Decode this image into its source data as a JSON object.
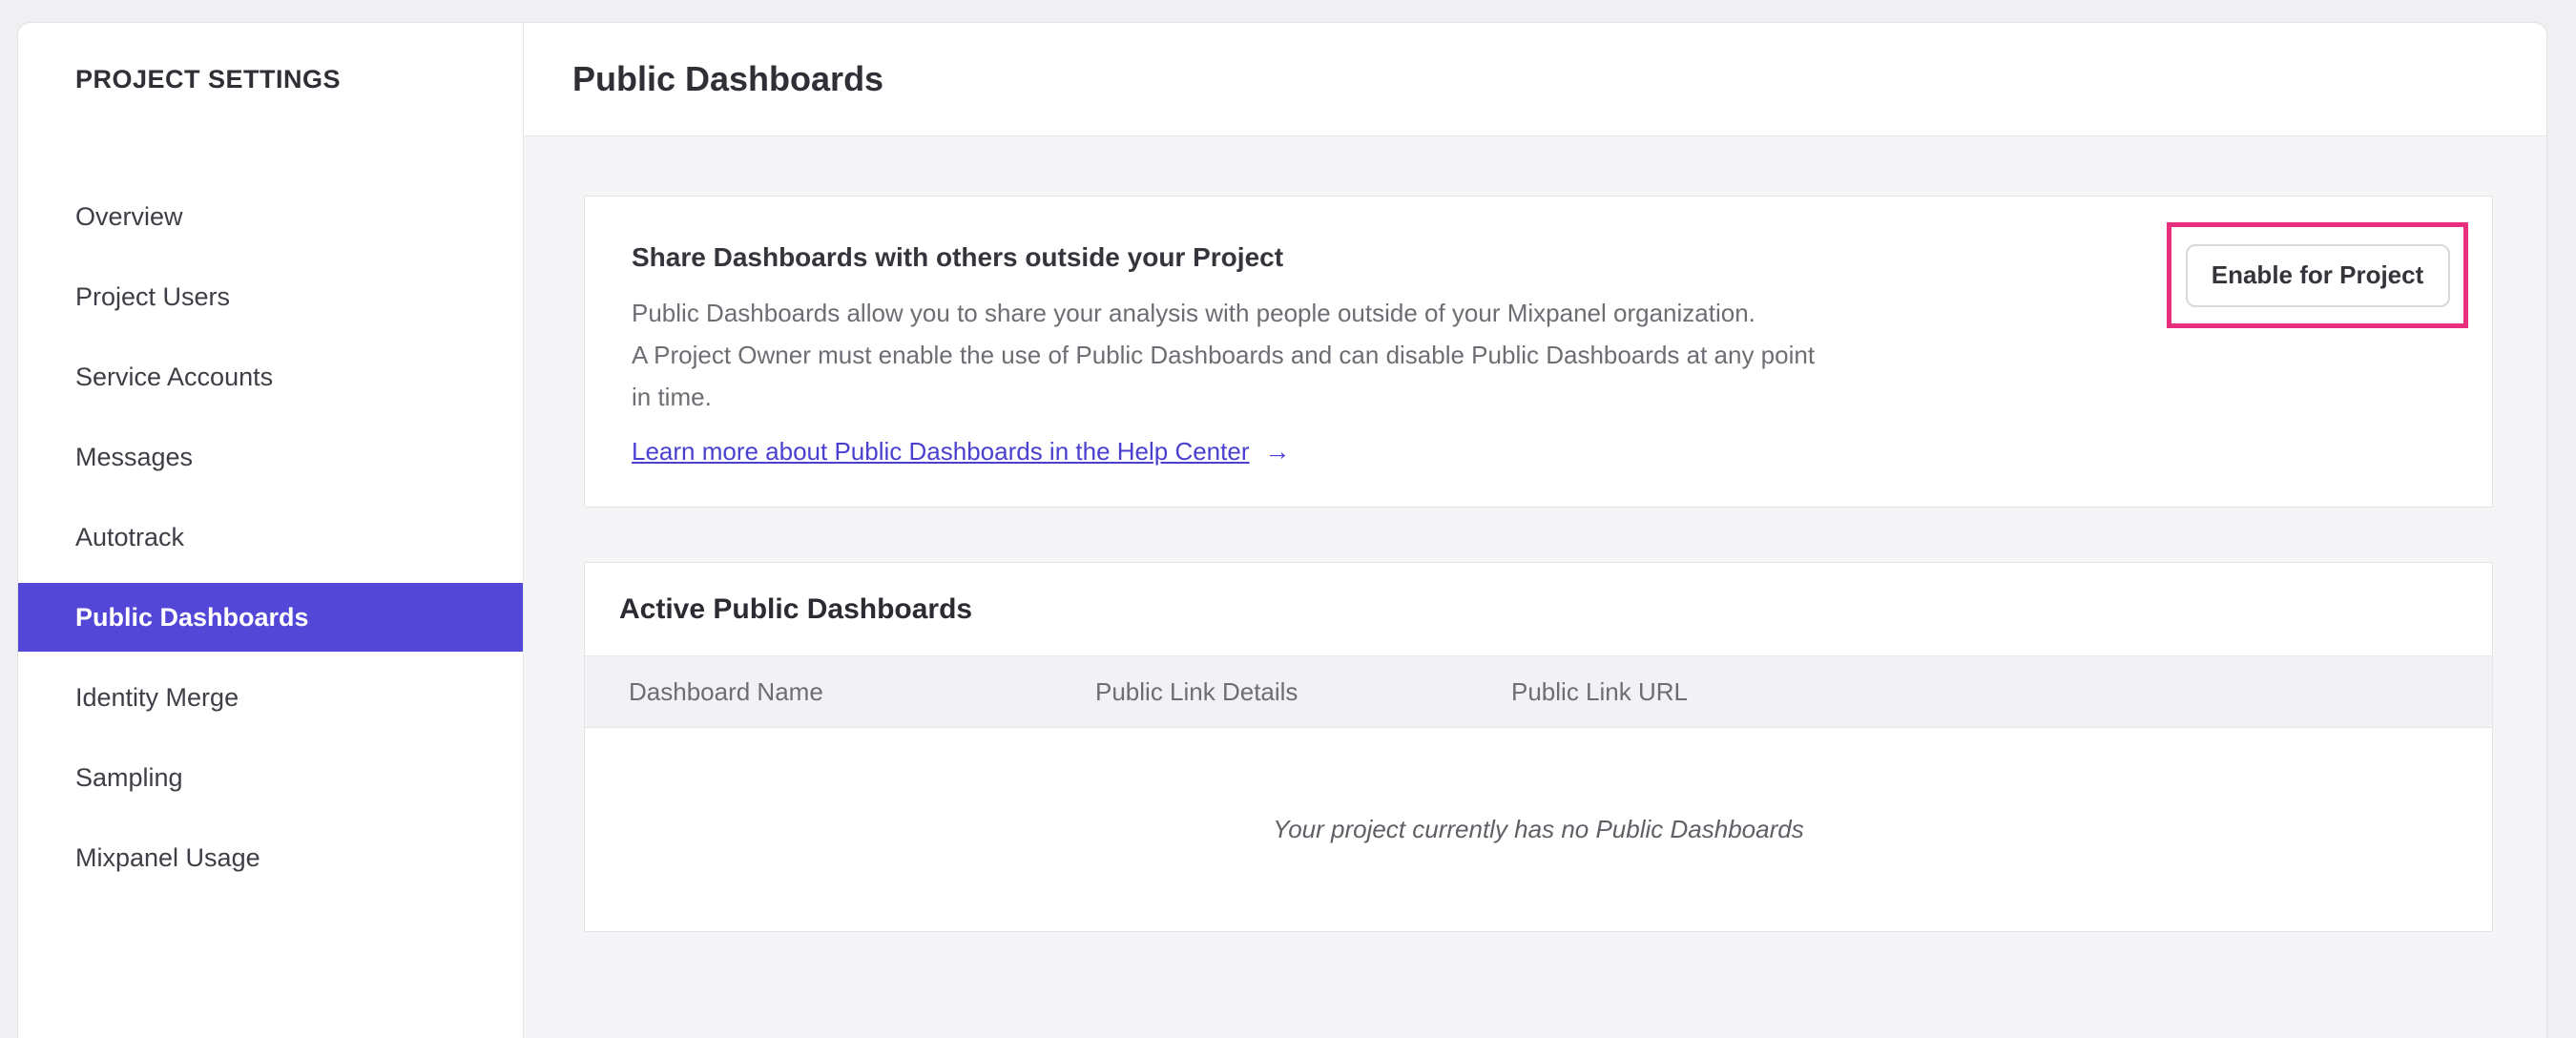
{
  "sidebar": {
    "title": "PROJECT SETTINGS",
    "items": [
      {
        "label": "Overview",
        "selected": false
      },
      {
        "label": "Project Users",
        "selected": false
      },
      {
        "label": "Service Accounts",
        "selected": false
      },
      {
        "label": "Messages",
        "selected": false
      },
      {
        "label": "Autotrack",
        "selected": false
      },
      {
        "label": "Public Dashboards",
        "selected": true
      },
      {
        "label": "Identity Merge",
        "selected": false
      },
      {
        "label": "Sampling",
        "selected": false
      },
      {
        "label": "Mixpanel Usage",
        "selected": false
      }
    ]
  },
  "header": {
    "title": "Public Dashboards"
  },
  "share_card": {
    "heading": "Share Dashboards with others outside your Project",
    "body_lines": [
      "Public Dashboards allow you to share your analysis with people outside of your Mixpanel organization.",
      "A Project Owner must enable the use of Public Dashboards and can disable Public Dashboards at any point",
      "in time."
    ],
    "link_label": "Learn more about Public Dashboards in the Help Center",
    "link_arrow": "→",
    "enable_button_label": "Enable for Project"
  },
  "active_card": {
    "title": "Active Public Dashboards",
    "columns": [
      "Dashboard Name",
      "Public Link Details",
      "Public Link URL"
    ],
    "empty_message": "Your project currently has no Public Dashboards"
  },
  "colors": {
    "accent": "#5347d8",
    "link": "#4a40d0",
    "annotation_pink": "#e72f7e",
    "page_background": "#f0f0f2",
    "content_background": "#f5f5f7"
  }
}
